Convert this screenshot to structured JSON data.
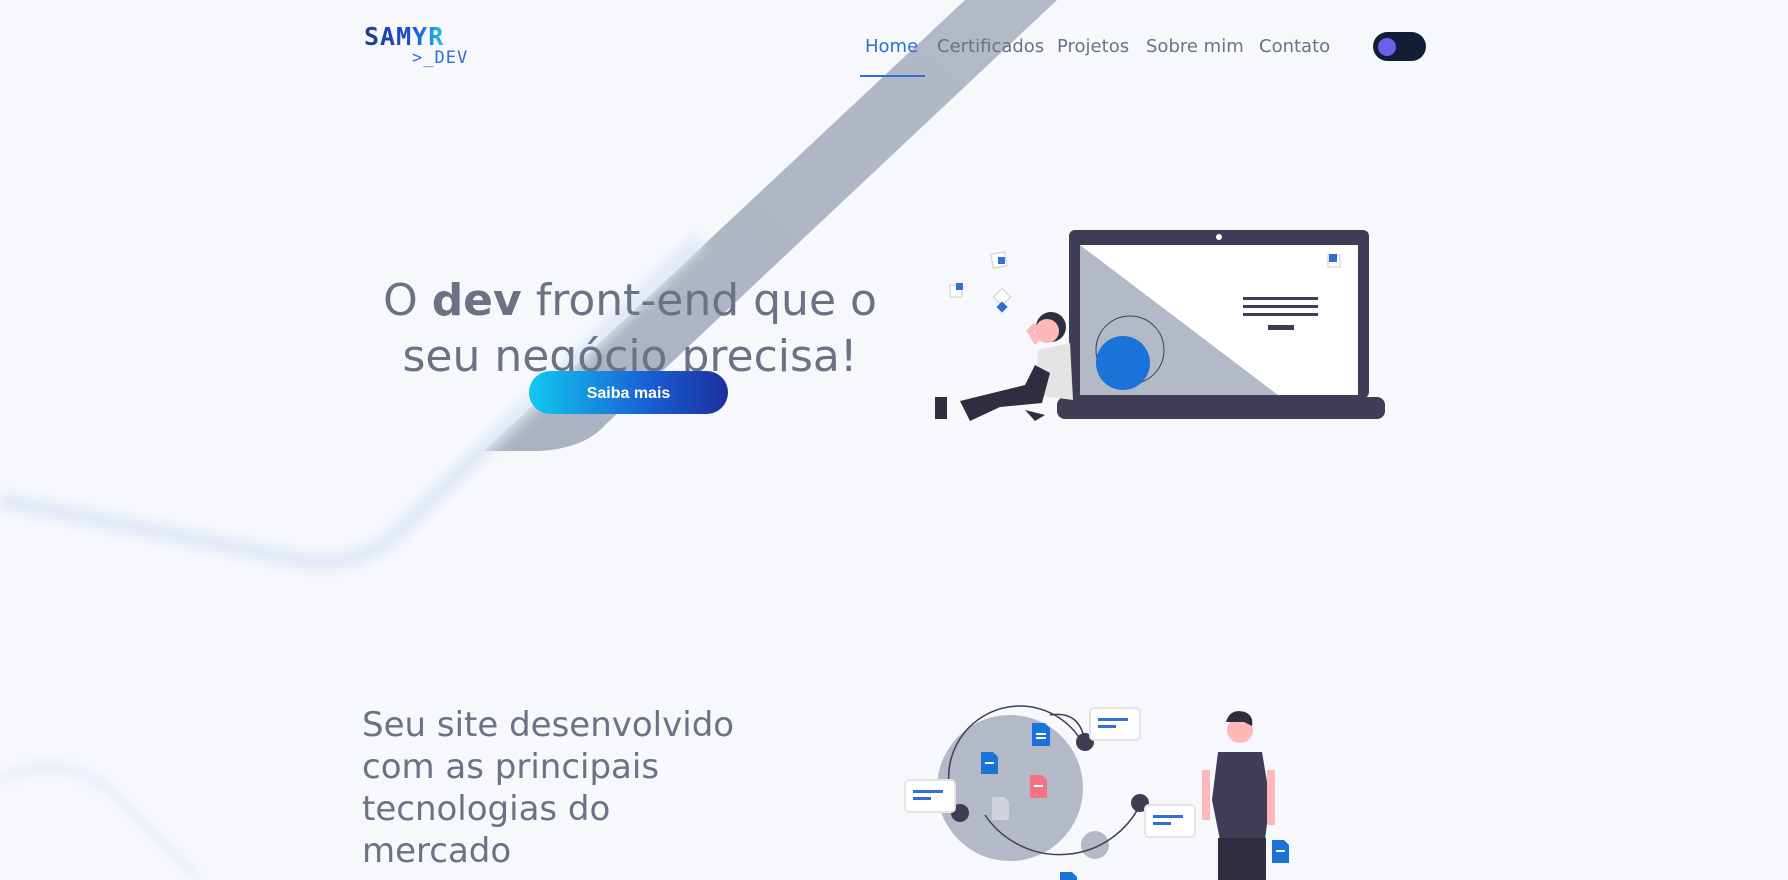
{
  "logo": {
    "line1": "SAMYR",
    "line2": ">_DEV"
  },
  "nav": {
    "items": [
      {
        "label": "Home",
        "active": true
      },
      {
        "label": "Certificados",
        "active": false
      },
      {
        "label": "Projetos",
        "active": false
      },
      {
        "label": "Sobre mim",
        "active": false
      },
      {
        "label": "Contato",
        "active": false
      }
    ]
  },
  "theme_toggle": {
    "icon": "theme-toggle",
    "state": "dark"
  },
  "hero": {
    "title_prefix": "O ",
    "title_bold": "dev",
    "title_suffix": " front-end que o seu negócio precisa!",
    "button_label": "Saiba mais"
  },
  "section2": {
    "title": "Seu site desenvolvido com as principais tecnologias do mercado"
  },
  "colors": {
    "accent": "#2f6fd6",
    "text": "#6b7285",
    "background": "#f6f8fc",
    "toggle_bg": "#141d36",
    "toggle_knob": "#6d5fea"
  }
}
